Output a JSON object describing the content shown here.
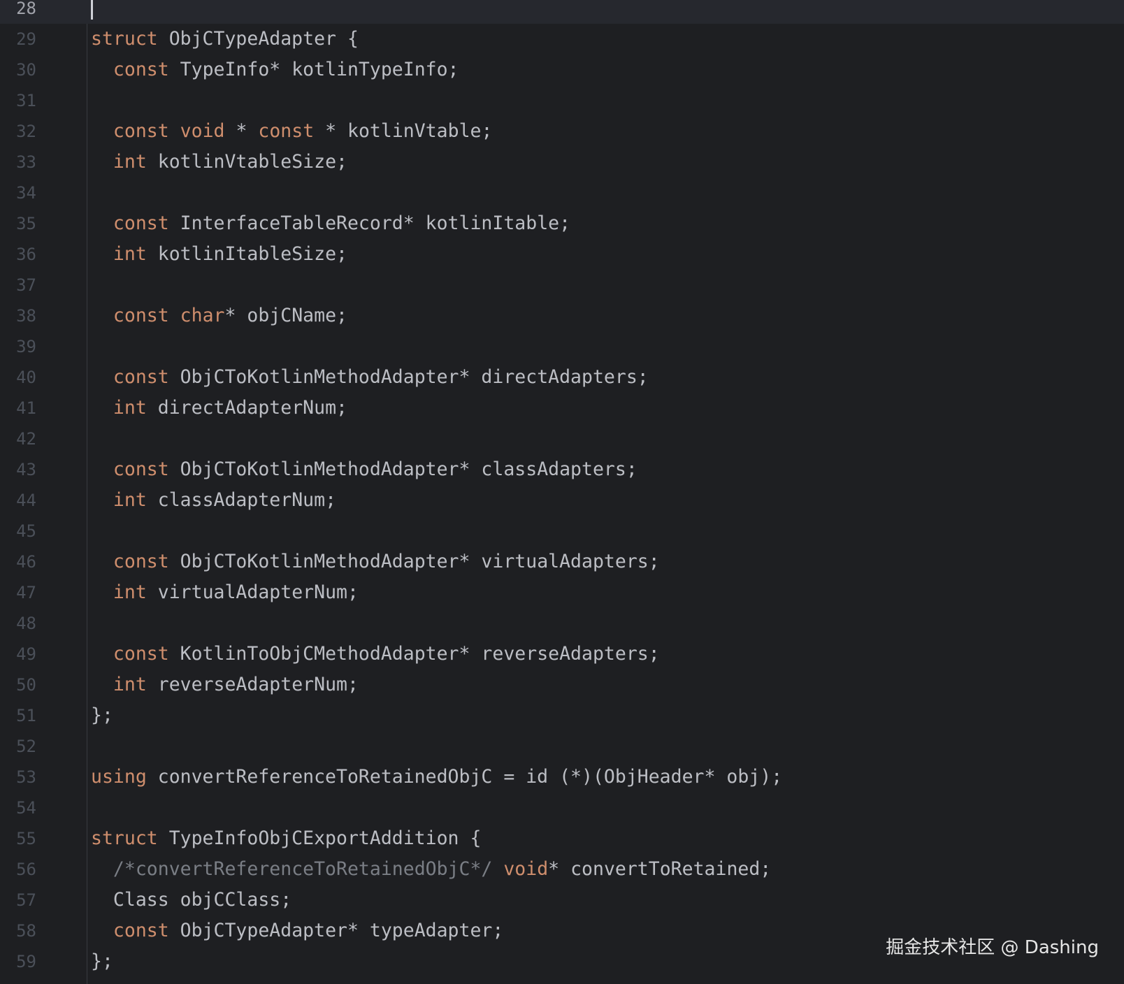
{
  "editor": {
    "current_line": "28",
    "lines": [
      {
        "n": "28",
        "segs": []
      },
      {
        "n": "29",
        "segs": [
          {
            "t": "kw",
            "v": "struct"
          },
          {
            "t": "tx",
            "v": " ObjCTypeAdapter {"
          }
        ]
      },
      {
        "n": "30",
        "segs": [
          {
            "t": "tx",
            "v": "  "
          },
          {
            "t": "kw",
            "v": "const"
          },
          {
            "t": "tx",
            "v": " TypeInfo* kotlinTypeInfo;"
          }
        ]
      },
      {
        "n": "31",
        "segs": []
      },
      {
        "n": "32",
        "segs": [
          {
            "t": "tx",
            "v": "  "
          },
          {
            "t": "kw",
            "v": "const"
          },
          {
            "t": "tx",
            "v": " "
          },
          {
            "t": "kw",
            "v": "void"
          },
          {
            "t": "tx",
            "v": " * "
          },
          {
            "t": "kw",
            "v": "const"
          },
          {
            "t": "tx",
            "v": " * kotlinVtable;"
          }
        ]
      },
      {
        "n": "33",
        "segs": [
          {
            "t": "tx",
            "v": "  "
          },
          {
            "t": "kw",
            "v": "int"
          },
          {
            "t": "tx",
            "v": " kotlinVtableSize;"
          }
        ]
      },
      {
        "n": "34",
        "segs": []
      },
      {
        "n": "35",
        "segs": [
          {
            "t": "tx",
            "v": "  "
          },
          {
            "t": "kw",
            "v": "const"
          },
          {
            "t": "tx",
            "v": " InterfaceTableRecord* kotlinItable;"
          }
        ]
      },
      {
        "n": "36",
        "segs": [
          {
            "t": "tx",
            "v": "  "
          },
          {
            "t": "kw",
            "v": "int"
          },
          {
            "t": "tx",
            "v": " kotlinItableSize;"
          }
        ]
      },
      {
        "n": "37",
        "segs": []
      },
      {
        "n": "38",
        "segs": [
          {
            "t": "tx",
            "v": "  "
          },
          {
            "t": "kw",
            "v": "const"
          },
          {
            "t": "tx",
            "v": " "
          },
          {
            "t": "kw",
            "v": "char"
          },
          {
            "t": "tx",
            "v": "* objCName;"
          }
        ]
      },
      {
        "n": "39",
        "segs": []
      },
      {
        "n": "40",
        "segs": [
          {
            "t": "tx",
            "v": "  "
          },
          {
            "t": "kw",
            "v": "const"
          },
          {
            "t": "tx",
            "v": " ObjCToKotlinMethodAdapter* directAdapters;"
          }
        ]
      },
      {
        "n": "41",
        "segs": [
          {
            "t": "tx",
            "v": "  "
          },
          {
            "t": "kw",
            "v": "int"
          },
          {
            "t": "tx",
            "v": " directAdapterNum;"
          }
        ]
      },
      {
        "n": "42",
        "segs": []
      },
      {
        "n": "43",
        "segs": [
          {
            "t": "tx",
            "v": "  "
          },
          {
            "t": "kw",
            "v": "const"
          },
          {
            "t": "tx",
            "v": " ObjCToKotlinMethodAdapter* classAdapters;"
          }
        ]
      },
      {
        "n": "44",
        "segs": [
          {
            "t": "tx",
            "v": "  "
          },
          {
            "t": "kw",
            "v": "int"
          },
          {
            "t": "tx",
            "v": " classAdapterNum;"
          }
        ]
      },
      {
        "n": "45",
        "segs": []
      },
      {
        "n": "46",
        "segs": [
          {
            "t": "tx",
            "v": "  "
          },
          {
            "t": "kw",
            "v": "const"
          },
          {
            "t": "tx",
            "v": " ObjCToKotlinMethodAdapter* virtualAdapters;"
          }
        ]
      },
      {
        "n": "47",
        "segs": [
          {
            "t": "tx",
            "v": "  "
          },
          {
            "t": "kw",
            "v": "int"
          },
          {
            "t": "tx",
            "v": " virtualAdapterNum;"
          }
        ]
      },
      {
        "n": "48",
        "segs": []
      },
      {
        "n": "49",
        "segs": [
          {
            "t": "tx",
            "v": "  "
          },
          {
            "t": "kw",
            "v": "const"
          },
          {
            "t": "tx",
            "v": " KotlinToObjCMethodAdapter* reverseAdapters;"
          }
        ]
      },
      {
        "n": "50",
        "segs": [
          {
            "t": "tx",
            "v": "  "
          },
          {
            "t": "kw",
            "v": "int"
          },
          {
            "t": "tx",
            "v": " reverseAdapterNum;"
          }
        ]
      },
      {
        "n": "51",
        "segs": [
          {
            "t": "tx",
            "v": "};"
          }
        ]
      },
      {
        "n": "52",
        "segs": []
      },
      {
        "n": "53",
        "segs": [
          {
            "t": "kw",
            "v": "using"
          },
          {
            "t": "tx",
            "v": " convertReferenceToRetainedObjC = id (*)(ObjHeader* obj);"
          }
        ]
      },
      {
        "n": "54",
        "segs": []
      },
      {
        "n": "55",
        "segs": [
          {
            "t": "kw",
            "v": "struct"
          },
          {
            "t": "tx",
            "v": " TypeInfoObjCExportAddition {"
          }
        ]
      },
      {
        "n": "56",
        "segs": [
          {
            "t": "tx",
            "v": "  "
          },
          {
            "t": "cm",
            "v": "/*convertReferenceToRetainedObjC*/"
          },
          {
            "t": "tx",
            "v": " "
          },
          {
            "t": "kw",
            "v": "void"
          },
          {
            "t": "tx",
            "v": "* convertToRetained;"
          }
        ]
      },
      {
        "n": "57",
        "segs": [
          {
            "t": "tx",
            "v": "  Class objCClass;"
          }
        ]
      },
      {
        "n": "58",
        "segs": [
          {
            "t": "tx",
            "v": "  "
          },
          {
            "t": "kw",
            "v": "const"
          },
          {
            "t": "tx",
            "v": " ObjCTypeAdapter* typeAdapter;"
          }
        ]
      },
      {
        "n": "59",
        "segs": [
          {
            "t": "tx",
            "v": "};"
          }
        ]
      }
    ]
  },
  "watermark": "掘金技术社区 @ Dashing",
  "colors": {
    "background": "#1e1f22",
    "keyword": "#cf8e6d",
    "text": "#bcbec4",
    "comment": "#7a7e85",
    "line_number": "#4b5059"
  }
}
